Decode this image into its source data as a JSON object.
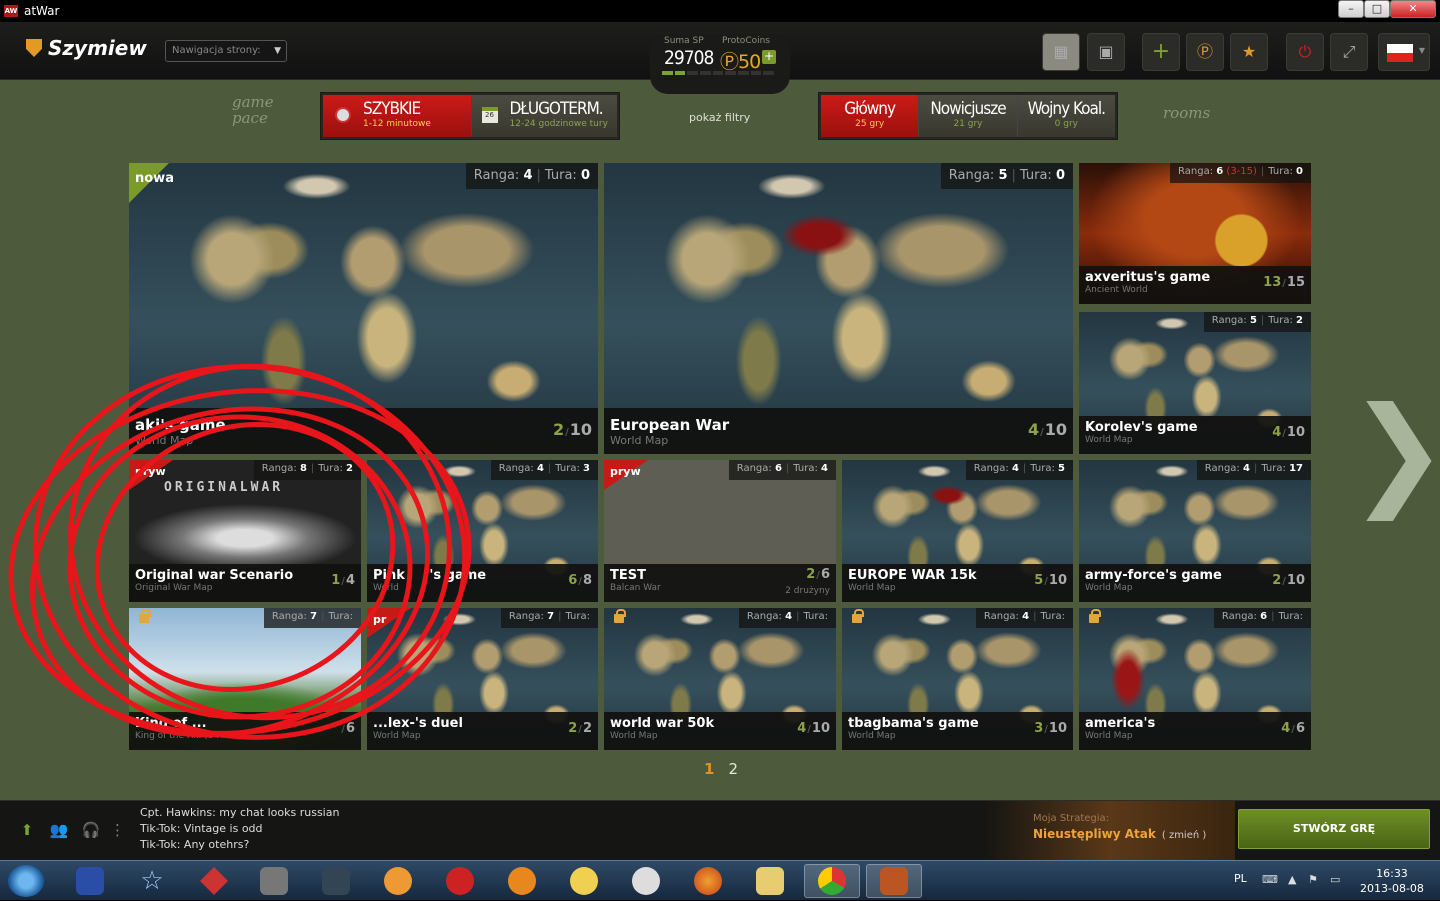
{
  "window": {
    "title": "atWar",
    "app_icon": "AW",
    "min": "–",
    "max": "□",
    "close": "✕"
  },
  "topbar": {
    "username": "Szymiew",
    "nav_select": "Nawigacja strony:",
    "sp_label": "Suma SP",
    "sp_value": "29708",
    "pc_label": "ProtoCoins",
    "pc_value": "50",
    "pc_add": "+",
    "buttons": [
      "grid-view-icon",
      "map-view-icon",
      "add-icon",
      "protocoin-icon",
      "star-medal-icon",
      "power-icon",
      "fullscreen-icon"
    ],
    "lang_flag": "PL"
  },
  "filters": {
    "pace_label": "game pace",
    "rooms_label": "rooms",
    "pace": [
      {
        "title": "SZYBKIE",
        "sub": "1-12 minutowe",
        "selected": true
      },
      {
        "title": "DŁUGOTERM.",
        "sub": "12-24 godzinowe tury",
        "selected": false
      }
    ],
    "show_filters": "pokaż filtry",
    "rooms": [
      {
        "title": "Główny",
        "sub": "25 gry",
        "selected": true
      },
      {
        "title": "Nowicjusze",
        "sub": "21 gry",
        "selected": false
      },
      {
        "title": "Wojny Koal.",
        "sub": "0 gry",
        "selected": false
      }
    ]
  },
  "games": [
    {
      "name": "aki's game",
      "map": "World Map",
      "rank_label": "Ranga:",
      "rank": "4",
      "turn_label": "Tura:",
      "turn": "0",
      "players": "2",
      "max": "10",
      "tag": "nowa"
    },
    {
      "name": "European War",
      "map": "World Map",
      "rank_label": "Ranga:",
      "rank": "5",
      "turn_label": "Tura:",
      "turn": "0",
      "players": "4",
      "max": "10"
    },
    {
      "name": "axveritus's game",
      "map": "Ancient World",
      "rank_label": "Ranga:",
      "rank": "6",
      "rank_range": "(3-15)",
      "turn_label": "Tura:",
      "turn": "0",
      "players": "13",
      "max": "15"
    },
    {
      "name": "Korolev's game",
      "map": "World Map",
      "rank_label": "Ranga:",
      "rank": "5",
      "turn_label": "Tura:",
      "turn": "2",
      "players": "4",
      "max": "10"
    },
    {
      "name": "Original war Scenario",
      "map": "Original War Map",
      "rank_label": "Ranga:",
      "rank": "8",
      "turn_label": "Tura:",
      "turn": "2",
      "players": "1",
      "max": "4",
      "tag": "pryw",
      "image_text": "ORIGINALWAR"
    },
    {
      "name": "Pink",
      "name2": "'s game",
      "map": "World",
      "rank_label": "Ranga:",
      "rank": "4",
      "turn_label": "Tura:",
      "turn": "3",
      "players": "6",
      "max": "8"
    },
    {
      "name": "TEST",
      "map": "Balcan War",
      "rank_label": "Ranga:",
      "rank": "6",
      "turn_label": "Tura:",
      "turn": "4",
      "players": "2",
      "max": "6",
      "sub": "2 drużyny",
      "tag": "pryw"
    },
    {
      "name": "EUROPE WAR 15k",
      "map": "World Map",
      "rank_label": "Ranga:",
      "rank": "4",
      "turn_label": "Tura:",
      "turn": "5",
      "players": "5",
      "max": "10"
    },
    {
      "name": "army-force's game",
      "map": "World Map",
      "rank_label": "Ranga:",
      "rank": "4",
      "turn_label": "Tura:",
      "turn": "17",
      "players": "2",
      "max": "10"
    },
    {
      "name": "King of ...",
      "map": "King of the Hill (6 Free)",
      "rank_label": "Ranga:",
      "rank": "7",
      "turn_label": "Tura:",
      "turn": "",
      "players": "",
      "max": "6"
    },
    {
      "name": "...lex-'s duel",
      "map": "World Map",
      "rank_label": "Ranga:",
      "rank": "7",
      "turn_label": "Tura:",
      "turn": "",
      "players": "2",
      "max": "2",
      "tag": "pr"
    },
    {
      "name": "world war 50k",
      "map": "World Map",
      "rank_label": "Ranga:",
      "rank": "4",
      "turn_label": "Tura:",
      "turn": "",
      "players": "4",
      "max": "10"
    },
    {
      "name": "tbagbama's game",
      "map": "World Map",
      "rank_label": "Ranga:",
      "rank": "4",
      "turn_label": "Tura:",
      "turn": "",
      "players": "3",
      "max": "10"
    },
    {
      "name": "america's",
      "map": "World Map",
      "rank_label": "Ranga:",
      "rank": "6",
      "turn_label": "Tura:",
      "turn": "",
      "players": "4",
      "max": "6"
    }
  ],
  "pager": {
    "current": "1",
    "next": "2"
  },
  "next_arrow": "❯",
  "chat": [
    {
      "from": "Cpt. Hawkins",
      "text": "my chat looks russian"
    },
    {
      "from": "Tik-Tok",
      "text": "Vintage is odd"
    },
    {
      "from": "Tik-Tok",
      "text": "Any otehrs?"
    }
  ],
  "chat_lines": [
    "Cpt. Hawkins: my chat looks russian",
    "Tik-Tok: Vintage is odd",
    "Tik-Tok: Any otehrs?"
  ],
  "strategy": {
    "label": "Moja Strategia:",
    "value": "Nieustępliwy Atak",
    "change": "( zmień )"
  },
  "create_button": "STWÓRZ GRĘ",
  "taskbar": {
    "lang": "PL",
    "time": "16:33",
    "date": "2013-08-08"
  },
  "colors": {
    "accent_red": "#cc1b18",
    "accent_green": "#7a9a2a",
    "accent_orange": "#e88f1e"
  }
}
